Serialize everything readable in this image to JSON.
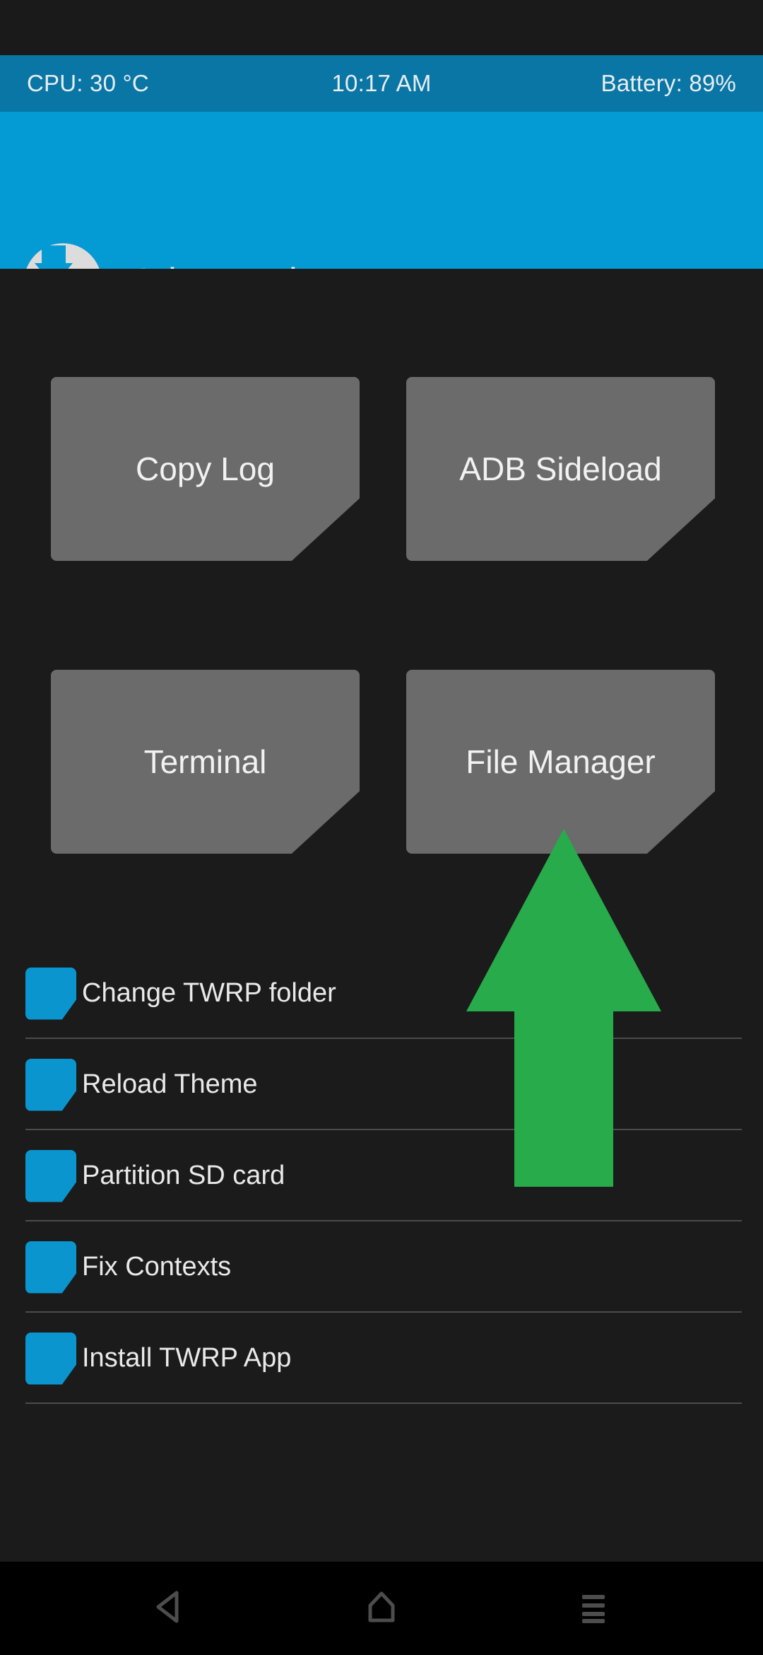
{
  "status_bar": {
    "cpu": "CPU: 30 °C",
    "time": "10:17 AM",
    "battery": "Battery: 89%",
    "background_color": "#0a76a6"
  },
  "header": {
    "title": "Advanced",
    "logo_icon": "twrp-logo-icon",
    "background_color": "#049ad3"
  },
  "main": {
    "tiles": [
      {
        "label": "Copy Log",
        "name": "copy-log-button"
      },
      {
        "label": "ADB Sideload",
        "name": "adb-sideload-button"
      },
      {
        "label": "Terminal",
        "name": "terminal-button"
      },
      {
        "label": "File Manager",
        "name": "file-manager-button"
      }
    ],
    "tile_color": "#6b6b6b",
    "list_items": [
      {
        "label": "Change TWRP folder",
        "icon": "list-bullet-icon"
      },
      {
        "label": "Reload Theme",
        "icon": "list-bullet-icon"
      },
      {
        "label": "Partition SD card",
        "icon": "list-bullet-icon"
      },
      {
        "label": "Fix Contexts",
        "icon": "list-bullet-icon"
      },
      {
        "label": "Install TWRP App",
        "icon": "list-bullet-icon"
      }
    ],
    "list_icon_color": "#0b95cf"
  },
  "annotation": {
    "type": "up-arrow",
    "color": "#28ab4b",
    "points_at": "File Manager"
  },
  "navbar": {
    "buttons": [
      {
        "name": "nav-back-button",
        "icon": "back-triangle-icon"
      },
      {
        "name": "nav-home-button",
        "icon": "home-icon"
      },
      {
        "name": "nav-recents-button",
        "icon": "menu-lines-icon"
      }
    ],
    "icon_color": "#4d4d4d"
  }
}
